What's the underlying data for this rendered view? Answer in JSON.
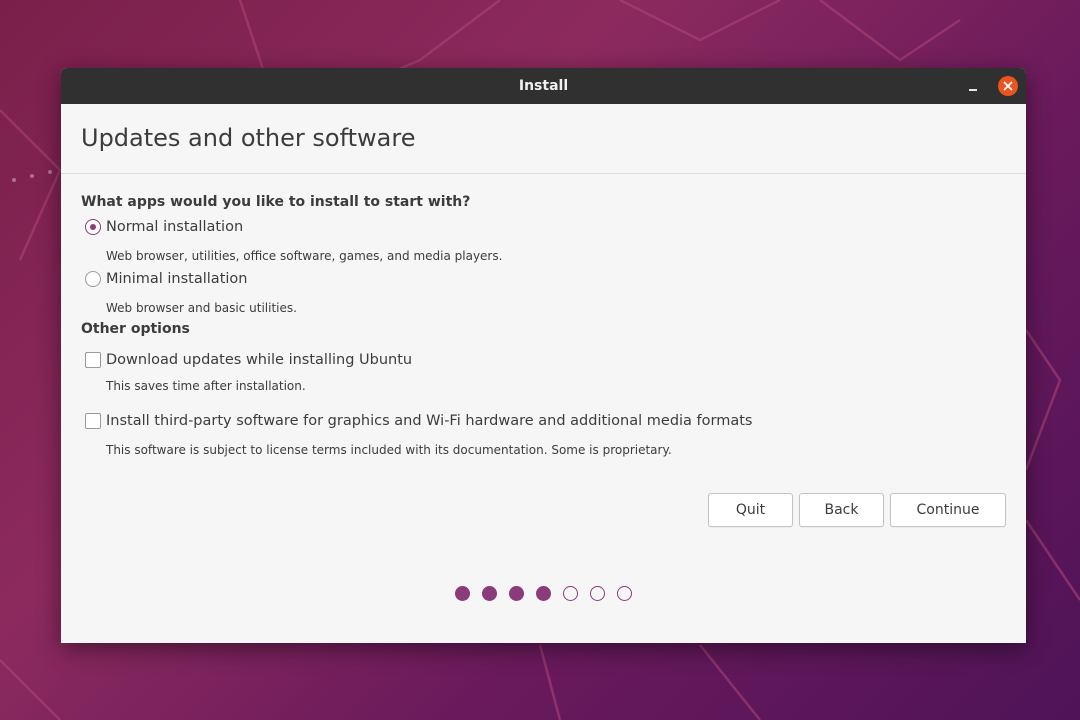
{
  "window": {
    "title": "Install"
  },
  "page": {
    "title": "Updates and other software"
  },
  "apps_section": {
    "question": "What apps would you like to install to start with?",
    "options": [
      {
        "label": "Normal installation",
        "description": "Web browser, utilities, office software, games, and media players.",
        "selected": true
      },
      {
        "label": "Minimal installation",
        "description": "Web browser and basic utilities.",
        "selected": false
      }
    ]
  },
  "other_options": {
    "heading": "Other options",
    "items": [
      {
        "label": "Download updates while installing Ubuntu",
        "description": "This saves time after installation.",
        "checked": false
      },
      {
        "label": "Install third-party software for graphics and Wi-Fi hardware and additional media formats",
        "description": "This software is subject to license terms included with its documentation. Some is proprietary.",
        "checked": false
      }
    ]
  },
  "buttons": {
    "quit": "Quit",
    "back": "Back",
    "continue": "Continue"
  },
  "progress": {
    "current_step": 4,
    "total_steps": 7
  },
  "colors": {
    "accent": "#8b3a7a",
    "close_button": "#e95420",
    "titlebar": "#303030"
  }
}
